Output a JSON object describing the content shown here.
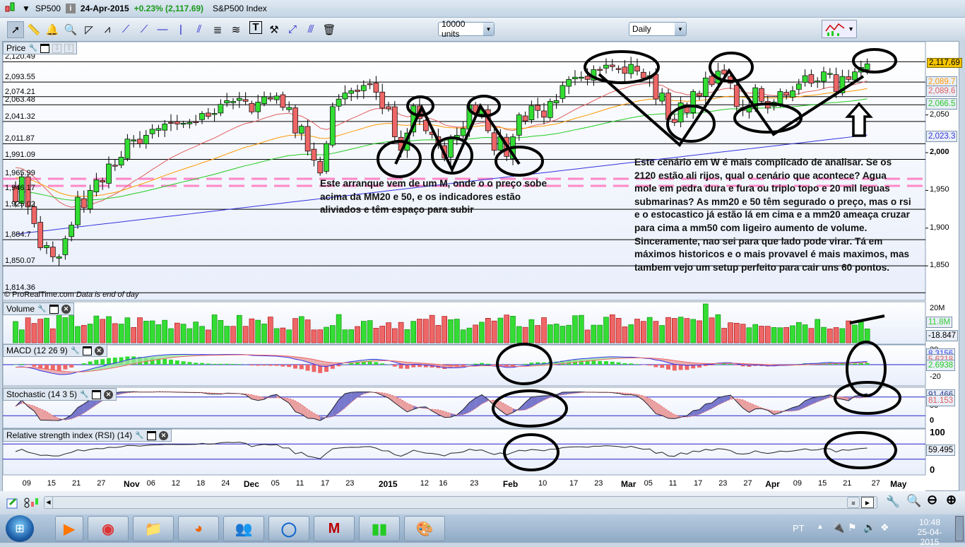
{
  "title": {
    "symbol": "SP500",
    "date": "24-Apr-2015",
    "change": "+0.23% (2,117.69)",
    "name": "S&P500 Index"
  },
  "toolbar": {
    "units": "10000 units",
    "period": "Daily",
    "tools": [
      "pointer-icon",
      "ruler-icon",
      "alarm-bell-icon",
      "zoom-magnifier-icon",
      "triangle-pattern-icon",
      "channel-icon",
      "trendline-icon",
      "ray-icon",
      "horizontal-line-icon",
      "vertical-line-icon",
      "parallel-lines-icon",
      "fibonacci-icon",
      "regression-icon",
      "text-icon",
      "tools-icon",
      "segment-icon",
      "parallel-segment-icon",
      "trash-icon"
    ]
  },
  "price_panel": {
    "label": "Price",
    "left_levels": [
      "2,120.49",
      "2,093.55",
      "2,074.21",
      "2,063.48",
      "2,041.32",
      "2,011.87",
      "1,991.09",
      "1,965.99",
      "1,946.17",
      "1,925.02",
      "1,884.7",
      "1,850.07",
      "1,814.36"
    ],
    "level_values": [
      2120.49,
      2093.55,
      2074.21,
      2063.48,
      2041.32,
      2011.87,
      1991.09,
      1965.99,
      1946.17,
      1925.02,
      1884.7,
      1850.07,
      1814.36
    ],
    "right_ticks": [
      "2,050",
      "2,000",
      "1,950",
      "1,900",
      "1,850"
    ],
    "right_tick_values": [
      2050,
      2000,
      1950,
      1900,
      1850
    ],
    "last_price": "2,117.69",
    "ma_labels": [
      {
        "text": "2,089.7",
        "color": "#ff9900"
      },
      {
        "text": "2,089.6",
        "color": "#e06060"
      },
      {
        "text": "2,066.5",
        "color": "#22cc22"
      },
      {
        "text": "2,023.3",
        "color": "#3333dd"
      }
    ],
    "copyright": "© ProRealTime.com",
    "eod": "Data is end of day",
    "closes": [
      1935,
      1968,
      1928,
      1906,
      1874,
      1877,
      1862,
      1862,
      1886,
      1904,
      1941,
      1927,
      1950,
      1964,
      1961,
      1985,
      1982,
      1994,
      2018,
      2017,
      2012,
      2023,
      2031,
      2032,
      2038,
      2039,
      2038,
      2039,
      2040,
      2041,
      2052,
      2048,
      2052,
      2064,
      2069,
      2068,
      2072,
      2068,
      2054,
      2067,
      2074,
      2071,
      2075,
      2060,
      2060,
      2026,
      2035,
      2002,
      1990,
      1973,
      2012,
      2061,
      2071,
      2079,
      2082,
      2081,
      2089,
      2091,
      2080,
      2059,
      2058,
      2021,
      2003,
      2026,
      2062,
      2045,
      2029,
      2024,
      2012,
      1993,
      2019,
      2023,
      2032,
      2063,
      2051,
      2057,
      2029,
      2003,
      2021,
      1995,
      2021,
      2050,
      2042,
      2062,
      2056,
      2047,
      2068,
      2069,
      2089,
      2097,
      2100,
      2100,
      2097,
      2110,
      2110,
      2116,
      2114,
      2111,
      2105,
      2117,
      2108,
      2099,
      2102,
      2071,
      2079,
      2044,
      2040,
      2066,
      2053,
      2081,
      2075,
      2099,
      2090,
      2108,
      2104,
      2092,
      2061,
      2056,
      2061,
      2086,
      2068,
      2059,
      2067,
      2081,
      2076,
      2082,
      2091,
      2102,
      2092,
      2095,
      2107,
      2105,
      2081,
      2101,
      2097,
      2107,
      2113,
      2117.69
    ],
    "notes": {
      "m": [
        "Este arranque vem de um M, onde o o preço sobe",
        "acima da MM20 e 50, e os indicadores estão",
        "aliviados e têm espaço para subir"
      ],
      "w": [
        "Este cenário em W é mais complicado de analisar. Se os",
        "2120 estão ali rijos, qual o cenário que acontece? Agua",
        "mole em pedra dura e fura ou triplo topo e 20 mil leguas",
        "submarinas? As mm20 e 50 têm segurado o preço, mas o rsi",
        "e o estocastico já estão lá em cima e a mm20 ameaça cruzar",
        "para cima a mm50 com ligeiro aumento de volume.",
        "Sinceramente, nao sei para que lado pode virar. Tá em",
        "máximos historicos e o mais provavel é mais maximos, mas",
        "tambem vejo um setup perfeito para cair uns 60 pontos."
      ]
    }
  },
  "volume_panel": {
    "label": "Volume",
    "top_tick": "20M",
    "last": "11.8M",
    "other": "-18.847"
  },
  "macd_panel": {
    "label": "MACD (12 26 9)",
    "ticks": [
      "20",
      "-20"
    ],
    "values": [
      {
        "text": "8.3156",
        "color": "#3344ee"
      },
      {
        "text": "5.6218",
        "color": "#e06060"
      },
      {
        "text": "2.6938",
        "color": "#22cc22"
      }
    ]
  },
  "stoch_panel": {
    "label": "Stochastic (14 3 5)",
    "ticks": [
      "50",
      "0"
    ],
    "values": [
      {
        "text": "91.466",
        "color": "#223388"
      },
      {
        "text": "81.153",
        "color": "#e06060"
      }
    ]
  },
  "rsi_panel": {
    "label": "Relative strength index (RSI) (14)",
    "ticks": [
      "100",
      "0"
    ],
    "value": "59.495"
  },
  "x_axis": {
    "labels": [
      "09",
      "15",
      "21",
      "27",
      "Nov",
      "06",
      "12",
      "18",
      "24",
      "Dec",
      "05",
      "11",
      "17",
      "23",
      "2015",
      "12",
      "16",
      "23",
      "Feb",
      "10",
      "17",
      "23",
      "Mar",
      "05",
      "11",
      "17",
      "23",
      "27",
      "Apr",
      "09",
      "15",
      "21",
      "27",
      "May"
    ]
  },
  "taskbar": {
    "lang": "PT",
    "time": "10:48",
    "date": "25-04-2015",
    "apps": [
      "media-player-icon",
      "chrome-icon",
      "file-explorer-icon",
      "firefox-icon",
      "messenger-icon",
      "app-circle-icon",
      "mcafee-icon",
      "prorealtime-icon",
      "paint-icon"
    ]
  },
  "colors": {
    "up": "#33dd33",
    "down": "#ee6666",
    "ma20": "#e06060",
    "ma50": "#ff9900",
    "ma100": "#22cc22",
    "ma200": "#3333dd",
    "annot_pink": "#ff88c8"
  }
}
